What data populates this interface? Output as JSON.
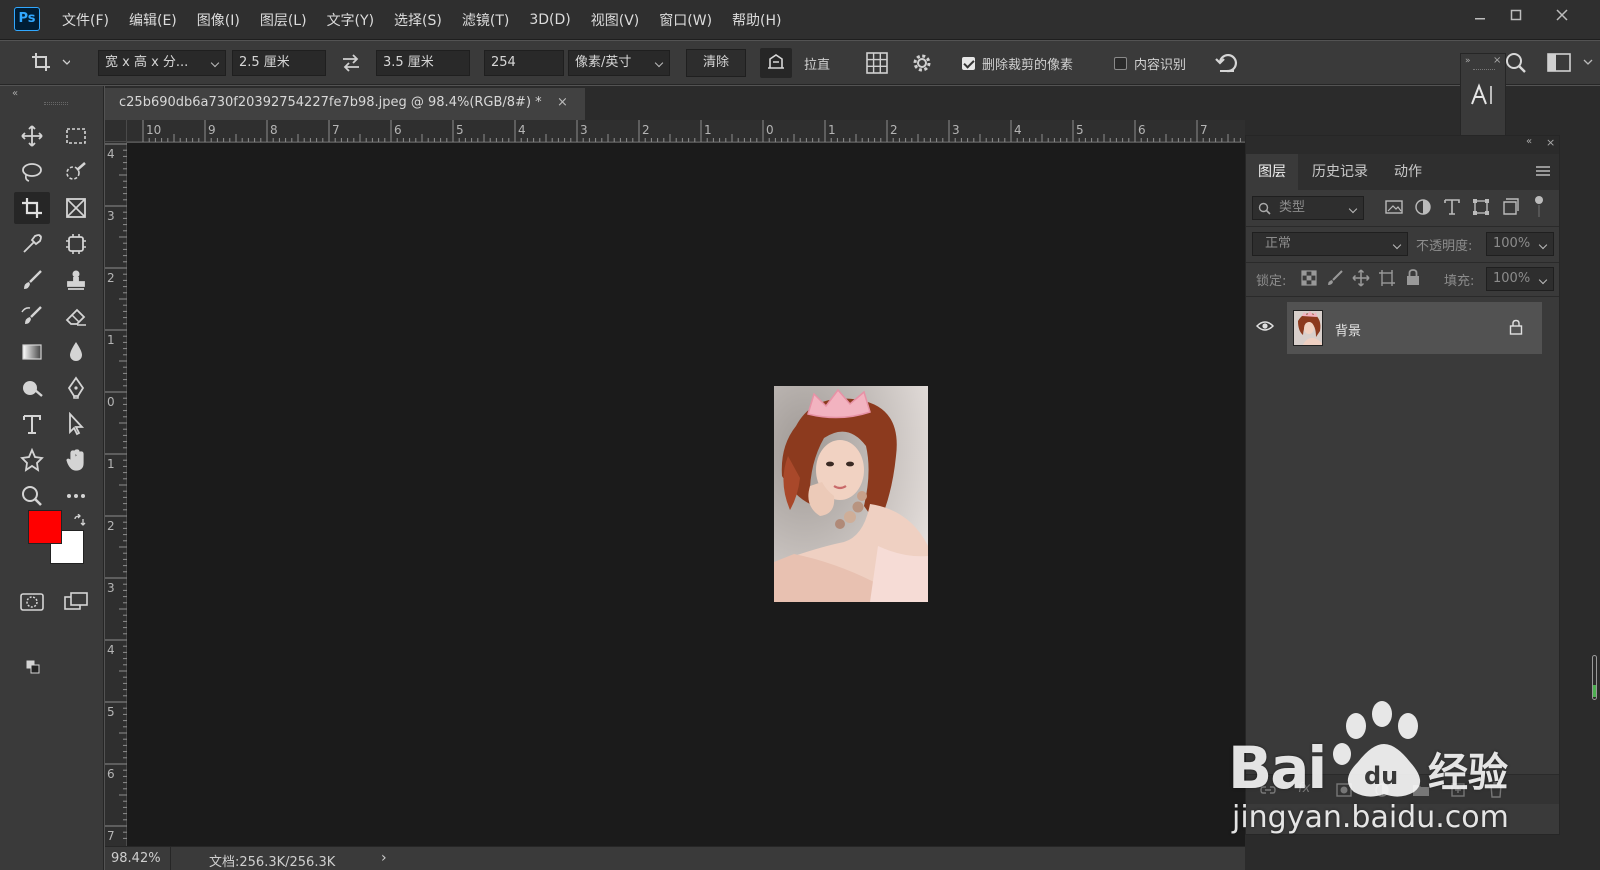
{
  "app": {
    "logo_text": "Ps"
  },
  "menu": {
    "items": [
      "文件(F)",
      "编辑(E)",
      "图像(I)",
      "图层(L)",
      "文字(Y)",
      "选择(S)",
      "滤镜(T)",
      "3D(D)",
      "视图(V)",
      "窗口(W)",
      "帮助(H)"
    ]
  },
  "options": {
    "ratio_preset": "宽 x 高 x 分...",
    "width_value": "2.5 厘米",
    "height_value": "3.5 厘米",
    "resolution_value": "254",
    "resolution_unit": "像素/英寸",
    "clear_label": "清除",
    "straighten_label": "拉直",
    "delete_cropped_label": "删除裁剪的像素",
    "delete_cropped_checked": true,
    "content_aware_label": "内容识别",
    "content_aware_checked": false
  },
  "document": {
    "tab_title": "c25b690db6a730f20392754227fe7b98.jpeg @ 98.4%(RGB/8#) *",
    "ruler_top_ticks": [
      "10",
      "9",
      "8",
      "7",
      "6",
      "5",
      "4",
      "3",
      "2",
      "1",
      "0",
      "1",
      "2",
      "3",
      "4",
      "5",
      "6",
      "7"
    ],
    "ruler_left_ticks": [
      "4",
      "3",
      "2",
      "1",
      "0",
      "1",
      "2",
      "3",
      "4",
      "5",
      "6",
      "7"
    ]
  },
  "status": {
    "zoom": "98.42%",
    "doc_size": "文档:256.3K/256.3K",
    "arrow": "›"
  },
  "panel": {
    "tabs": [
      "图层",
      "历史记录",
      "动作"
    ],
    "filter_placeholder": "类型",
    "blend_mode": "正常",
    "opacity_label": "不透明度:",
    "opacity_value": "100%",
    "lock_label": "锁定:",
    "fill_label": "填充:",
    "fill_value": "100%",
    "layer_name": "背景"
  },
  "watermark": {
    "brand": "Bai",
    "brand_suffix": "经验",
    "url": "jingyan.baidu.com"
  },
  "colors": {
    "foreground": "#ff0000",
    "background": "#ffffff",
    "ps_blue": "#31a8ff"
  }
}
